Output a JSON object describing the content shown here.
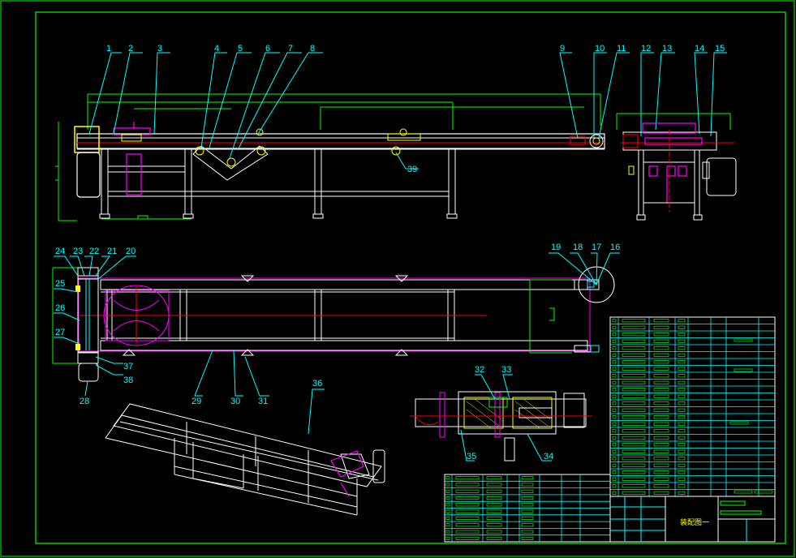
{
  "colors": {
    "background": "#000000",
    "frame": "#00ff00",
    "leader": "#00ffff",
    "frame_lines": "#ffffff",
    "accent": "#ff00ff",
    "centerline": "#ff0000",
    "yellow": "#ffff00",
    "grid": "#00ffff"
  },
  "callouts_top": [
    "1",
    "2",
    "3",
    "4",
    "5",
    "6",
    "7",
    "8",
    "9",
    "10",
    "11",
    "12",
    "13",
    "14",
    "15"
  ],
  "callout_39": "39",
  "callouts_mid_right": [
    "19",
    "18",
    "17",
    "16"
  ],
  "callouts_mid_left": [
    "24",
    "23",
    "22",
    "21",
    "20"
  ],
  "callouts_left_side": [
    "25",
    "26",
    "27"
  ],
  "callouts_bottom_left": [
    "37",
    "38",
    "28",
    "29",
    "30",
    "31"
  ],
  "callouts_section": [
    "32",
    "33",
    "35",
    "34"
  ],
  "callout_iso": "36",
  "title_block_label": "装配图一"
}
